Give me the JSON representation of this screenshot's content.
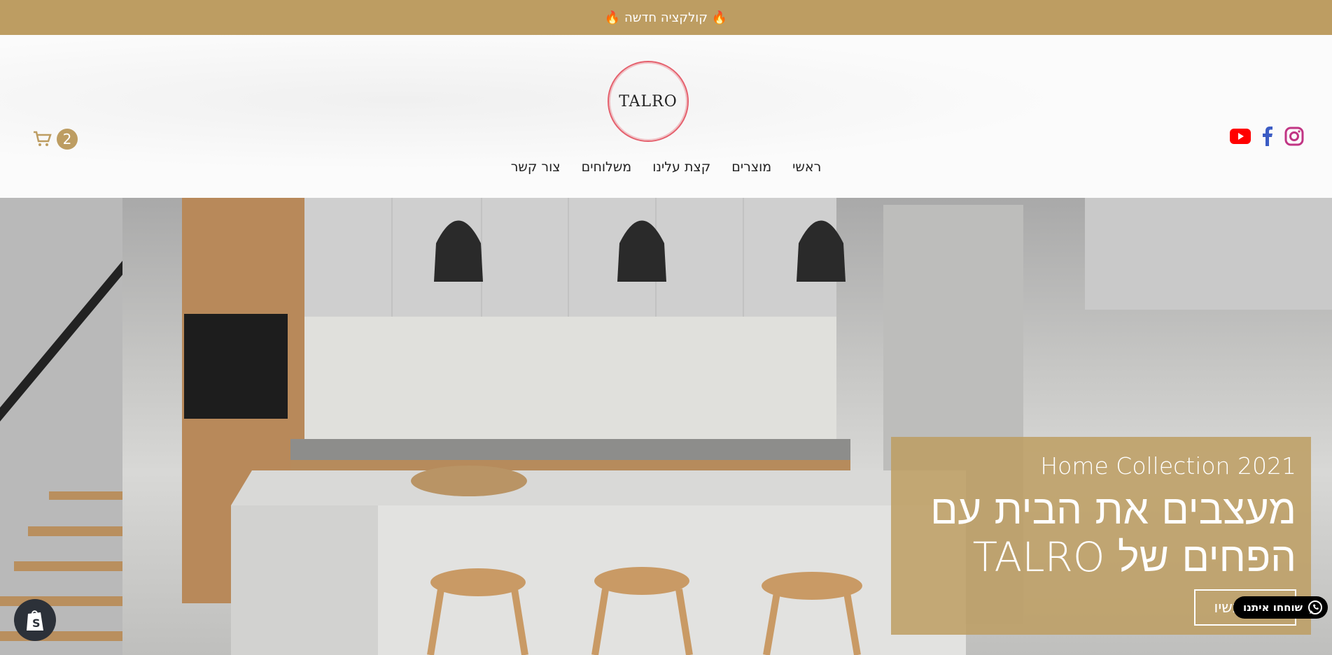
{
  "announcement": {
    "text": "🔥 קולקציה חדשה 🔥"
  },
  "header": {
    "logo_text": "TALRO",
    "cart_count": "2",
    "social": [
      "youtube-icon",
      "facebook-icon",
      "instagram-icon"
    ],
    "nav": [
      "ראשי",
      "מוצרים",
      "קצת עלינו",
      "משלוחים",
      "צור קשר"
    ]
  },
  "hero": {
    "subtitle": "Home Collection 2021",
    "heading_line1": "מעצבים את הבית עם",
    "heading_line2": "הפחים של TALRO",
    "button": "קנו עכשיו"
  },
  "whatsapp": {
    "label": "שוחחו איתנו"
  },
  "colors": {
    "brand": "#bd9d62",
    "logo_ring": "#e5606d"
  }
}
